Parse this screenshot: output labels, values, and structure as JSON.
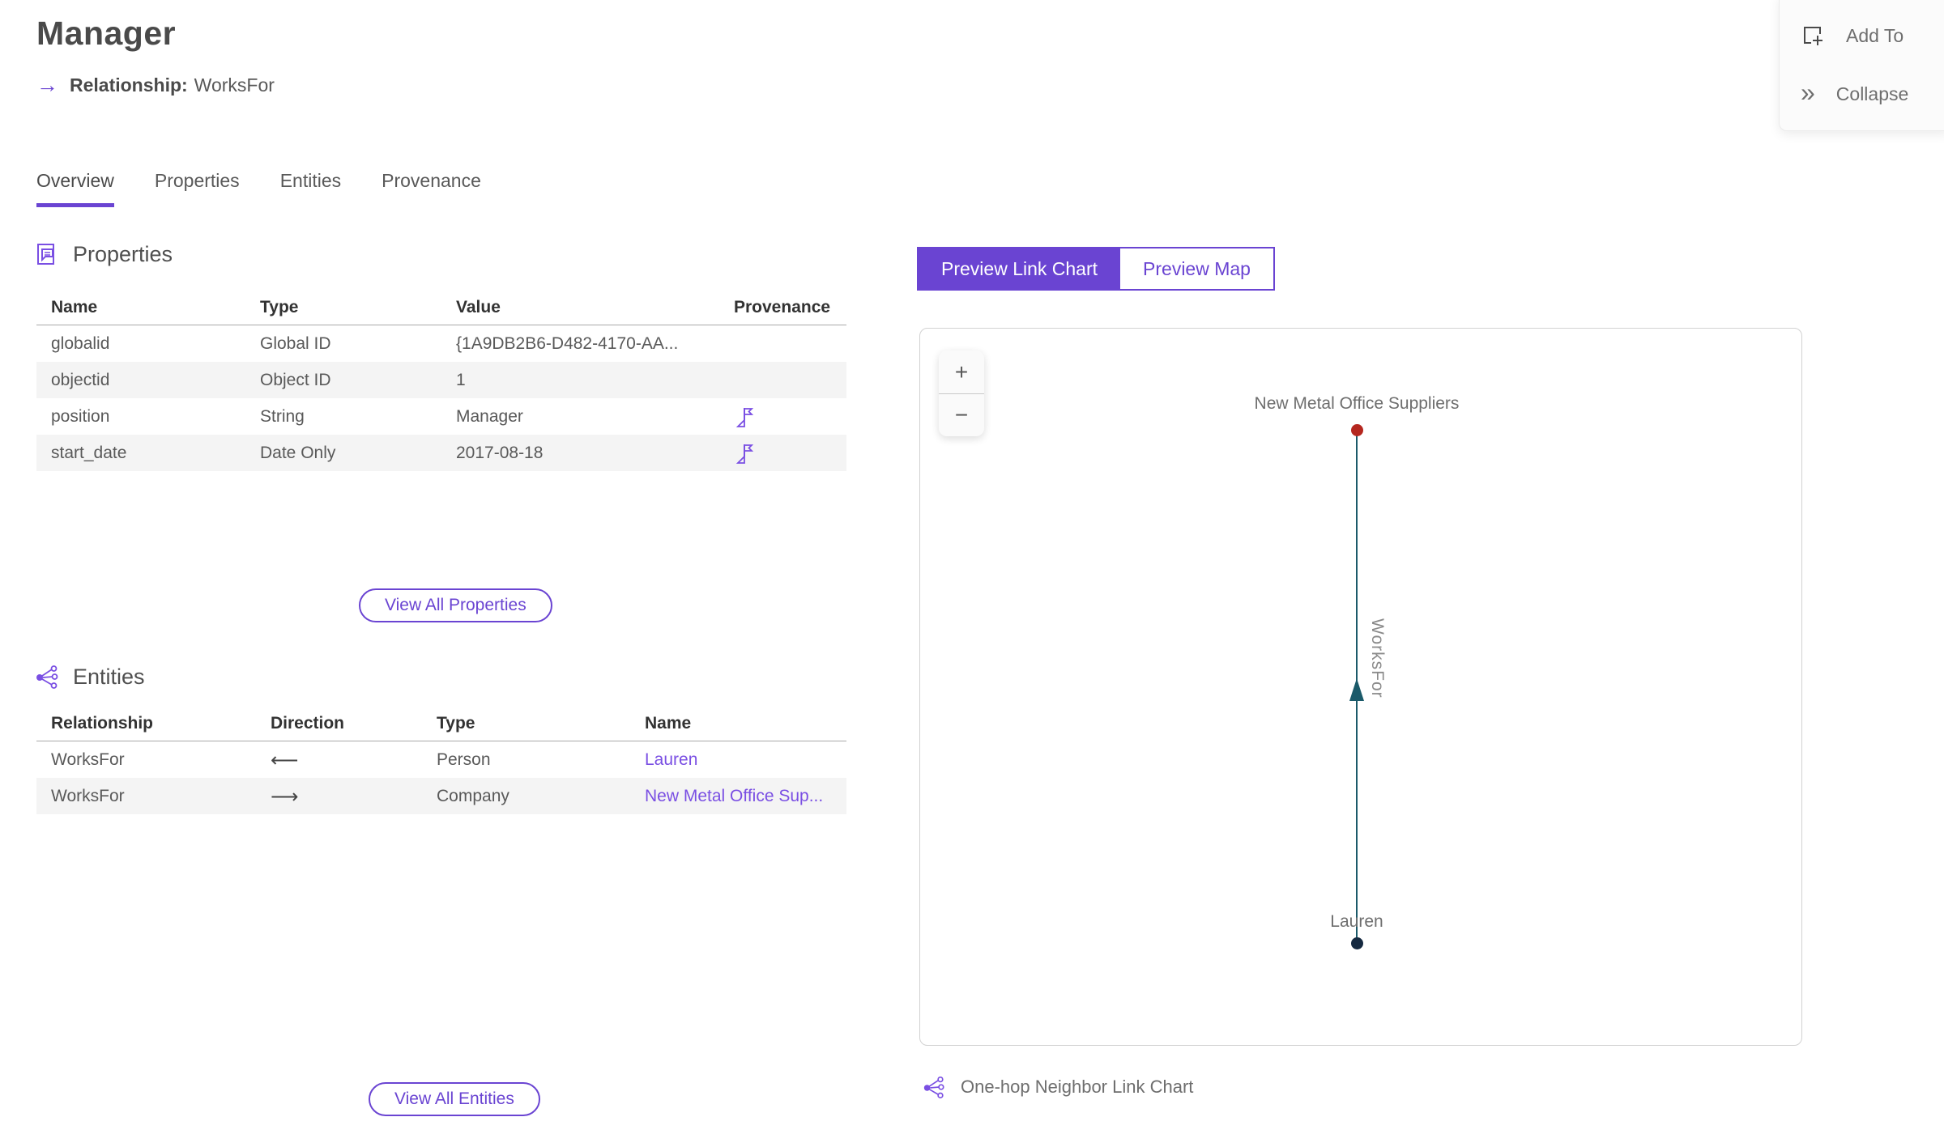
{
  "header": {
    "title": "Manager",
    "arrow_glyph": "→",
    "subtitle_label": "Relationship:",
    "subtitle_value": "WorksFor"
  },
  "actions": {
    "add_to_label": "Add To",
    "collapse_label": "Collapse",
    "collapse_glyph": "»"
  },
  "tabs": {
    "items": [
      {
        "label": "Overview",
        "active": true
      },
      {
        "label": "Properties",
        "active": false
      },
      {
        "label": "Entities",
        "active": false
      },
      {
        "label": "Provenance",
        "active": false
      }
    ]
  },
  "properties_section": {
    "title": "Properties",
    "columns": [
      "Name",
      "Type",
      "Value",
      "Provenance"
    ],
    "rows": [
      {
        "name": "globalid",
        "type": "Global ID",
        "value": "{1A9DB2B6-D482-4170-AA...",
        "has_provenance": false
      },
      {
        "name": "objectid",
        "type": "Object ID",
        "value": "1",
        "has_provenance": false
      },
      {
        "name": "position",
        "type": "String",
        "value": "Manager",
        "has_provenance": true
      },
      {
        "name": "start_date",
        "type": "Date Only",
        "value": "2017-08-18",
        "has_provenance": true
      }
    ],
    "view_all_label": "View All Properties"
  },
  "entities_section": {
    "title": "Entities",
    "columns": [
      "Relationship",
      "Direction",
      "Type",
      "Name"
    ],
    "rows": [
      {
        "relationship": "WorksFor",
        "direction": "⟵",
        "type": "Person",
        "name": "Lauren"
      },
      {
        "relationship": "WorksFor",
        "direction": "⟶",
        "type": "Company",
        "name": "New Metal Office Sup..."
      }
    ],
    "view_all_label": "View All Entities"
  },
  "preview": {
    "link_chart_label": "Preview Link Chart",
    "map_label": "Preview Map",
    "zoom_in_glyph": "+",
    "zoom_out_glyph": "−",
    "caption": "One-hop Neighbor Link Chart",
    "graph": {
      "top_node_label": "New Metal Office Suppliers",
      "bottom_node_label": "Lauren",
      "edge_label": "WorksFor",
      "edge_direction": "up"
    }
  },
  "colors": {
    "accent": "#6a44d2",
    "link": "#7a4fe3",
    "edge": "#1b5a6a",
    "node-top": "#b5271f",
    "node-bottom": "#152940",
    "text-dark": "#4a4a4a",
    "text-body": "#595959",
    "text-muted": "#6e6e6e",
    "row-alt": "#f4f4f4"
  }
}
